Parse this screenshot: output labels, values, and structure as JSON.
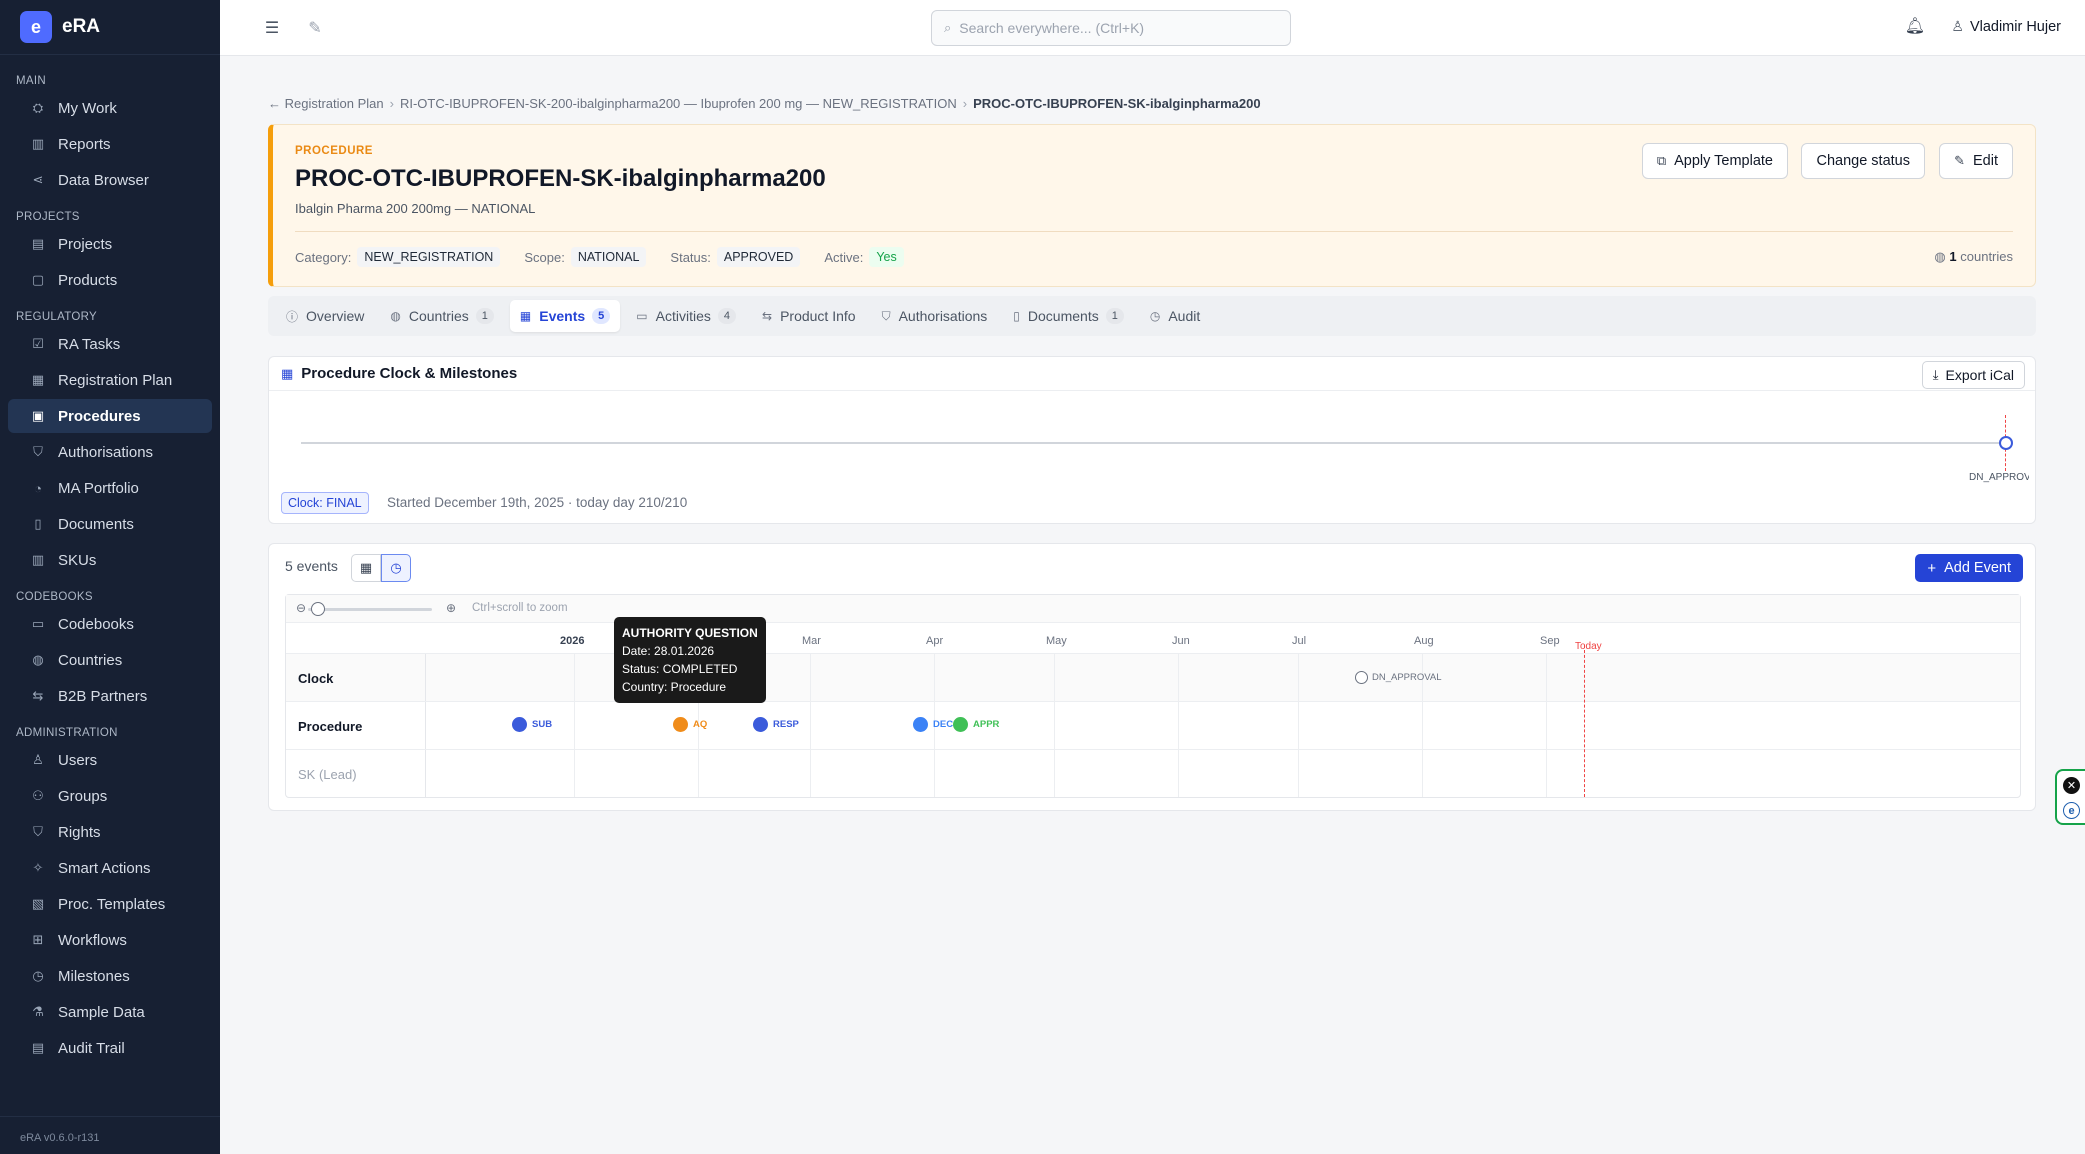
{
  "brand": {
    "logo_letter": "e",
    "name": "eRA"
  },
  "sidebar": {
    "sections": [
      {
        "title": "MAIN",
        "items": [
          {
            "label": "My Work",
            "icon": "rocket-icon"
          },
          {
            "label": "Reports",
            "icon": "bar-chart-icon"
          },
          {
            "label": "Data Browser",
            "icon": "share-icon"
          }
        ]
      },
      {
        "title": "PROJECTS",
        "items": [
          {
            "label": "Projects",
            "icon": "list-box-icon"
          },
          {
            "label": "Products",
            "icon": "box-icon"
          }
        ]
      },
      {
        "title": "REGULATORY",
        "items": [
          {
            "label": "RA Tasks",
            "icon": "checkbox-icon"
          },
          {
            "label": "Registration Plan",
            "icon": "clipboard-icon"
          },
          {
            "label": "Procedures",
            "icon": "clipboard-list-icon",
            "active": true
          },
          {
            "label": "Authorisations",
            "icon": "shield-icon"
          },
          {
            "label": "MA Portfolio",
            "icon": "pie-chart-icon"
          },
          {
            "label": "Documents",
            "icon": "file-icon"
          },
          {
            "label": "SKUs",
            "icon": "barcode-icon"
          }
        ]
      },
      {
        "title": "CODEBOOKS",
        "items": [
          {
            "label": "Codebooks",
            "icon": "book-icon"
          },
          {
            "label": "Countries",
            "icon": "globe-icon"
          },
          {
            "label": "B2B Partners",
            "icon": "swap-icon"
          }
        ]
      },
      {
        "title": "ADMINISTRATION",
        "items": [
          {
            "label": "Users",
            "icon": "user-icon"
          },
          {
            "label": "Groups",
            "icon": "users-icon"
          },
          {
            "label": "Rights",
            "icon": "shield-check-icon"
          },
          {
            "label": "Smart Actions",
            "icon": "sparkles-icon"
          },
          {
            "label": "Proc. Templates",
            "icon": "template-icon"
          },
          {
            "label": "Workflows",
            "icon": "workflow-icon"
          },
          {
            "label": "Milestones",
            "icon": "clock-icon"
          },
          {
            "label": "Sample Data",
            "icon": "flask-icon"
          },
          {
            "label": "Audit Trail",
            "icon": "audit-icon"
          }
        ]
      }
    ],
    "version": "eRA v0.6.0-r131"
  },
  "topbar": {
    "search_placeholder": "Search everywhere... (Ctrl+K)",
    "user_name": "Vladimir Hujer"
  },
  "breadcrumb": {
    "back": "← Registration Plan",
    "middle": "RI-OTC-IBUPROFEN-SK-200-ibalginpharma200 — Ibuprofen 200 mg — NEW_REGISTRATION",
    "current": "PROC-OTC-IBUPROFEN-SK-ibalginpharma200"
  },
  "procedure": {
    "label": "PROCEDURE",
    "title": "PROC-OTC-IBUPROFEN-SK-ibalginpharma200",
    "subtitle": "Ibalgin Pharma 200 200mg — NATIONAL",
    "meta": [
      {
        "key": "Category:",
        "value": "NEW_REGISTRATION"
      },
      {
        "key": "Scope:",
        "value": "NATIONAL"
      },
      {
        "key": "Status:",
        "value": "APPROVED"
      },
      {
        "key": "Active:",
        "value": "Yes"
      }
    ],
    "countries_count": "1",
    "countries_label": "countries",
    "buttons": {
      "apply_template": "Apply Template",
      "change_status": "Change status",
      "edit": "Edit"
    }
  },
  "tabs": [
    {
      "label": "Overview",
      "icon": "info-icon"
    },
    {
      "label": "Countries",
      "icon": "globe-icon",
      "count": "1"
    },
    {
      "label": "Events",
      "icon": "calendar-icon",
      "count": "5",
      "active": true
    },
    {
      "label": "Activities",
      "icon": "activity-icon",
      "count": "4"
    },
    {
      "label": "Product Info",
      "icon": "swap-icon"
    },
    {
      "label": "Authorisations",
      "icon": "shield-icon"
    },
    {
      "label": "Documents",
      "icon": "file-icon",
      "count": "1"
    },
    {
      "label": "Audit",
      "icon": "history-icon"
    }
  ],
  "clock": {
    "title": "Procedure Clock & Milestones",
    "export_label": "Export iCal",
    "milestone_label": "DN_APPROVAL",
    "badge": "Clock: FINAL",
    "started": "Started December 19th, 2025 · today day 210/210"
  },
  "events": {
    "count_label": "5 events",
    "add_label": "Add Event",
    "zoom_hint": "Ctrl+scroll to zoom",
    "months": [
      "2026",
      "Mar",
      "Apr",
      "May",
      "Jun",
      "Jul",
      "Aug",
      "Sep"
    ],
    "today_label": "Today",
    "lanes": [
      "Clock",
      "Procedure",
      "SK (Lead)"
    ],
    "clock_milestone": "DN_APPROVAL",
    "items": [
      {
        "label": "SUB",
        "color": "#3b5bdb"
      },
      {
        "label": "AQ",
        "color": "#f08c1a"
      },
      {
        "label": "RESP",
        "color": "#3b5bdb"
      },
      {
        "label": "DEC",
        "color": "#3b82f6"
      },
      {
        "label": "APPR",
        "color": "#40c057"
      }
    ]
  },
  "tooltip": {
    "title": "AUTHORITY QUESTION",
    "date": "Date: 28.01.2026",
    "status": "Status: COMPLETED",
    "country": "Country: Procedure"
  }
}
